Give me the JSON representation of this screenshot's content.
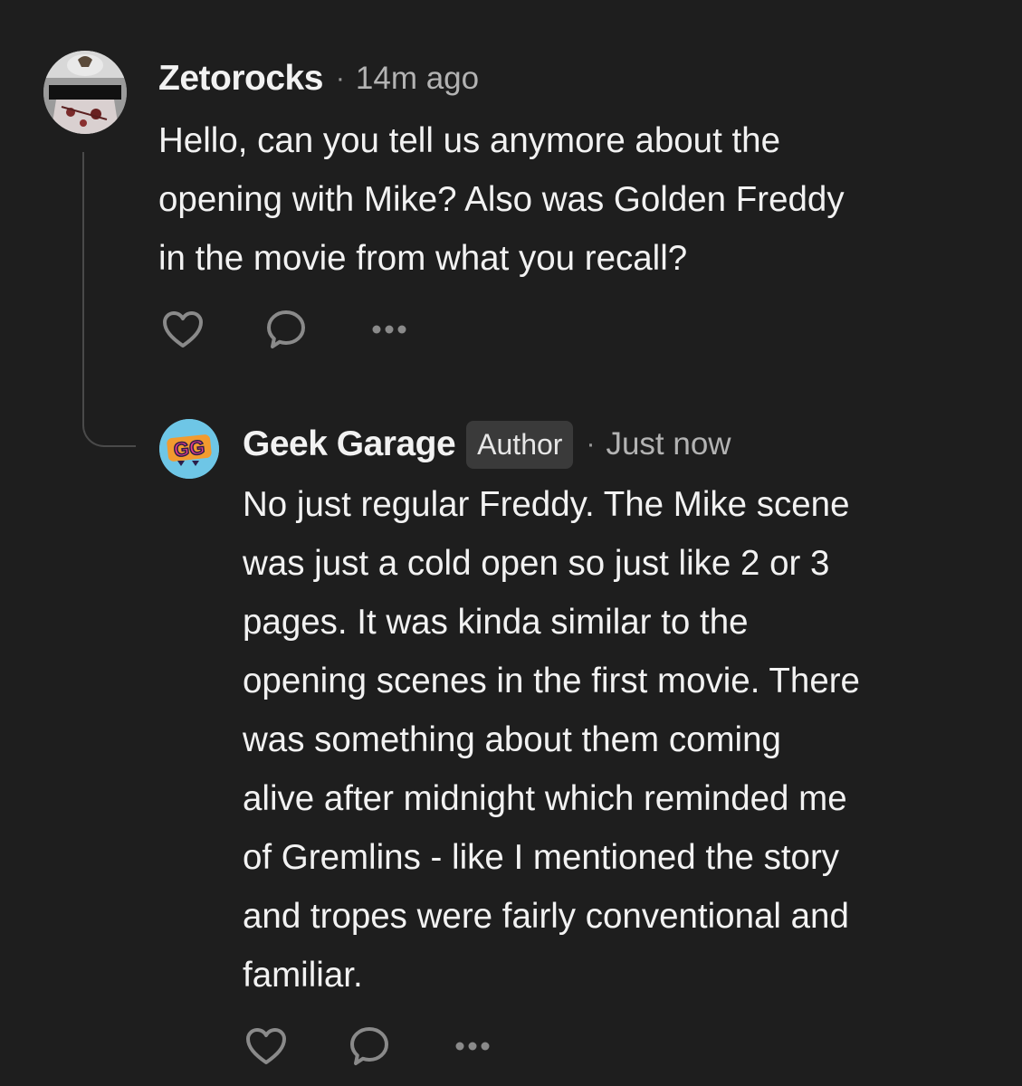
{
  "comments": [
    {
      "username": "Zetorocks",
      "separator": "·",
      "time": "14m ago",
      "avatar_icon": "user-avatar-icon",
      "lines": [
        "Hello, can you tell us anymore about the",
        "opening with Mike? Also was Golden Freddy",
        "in the movie from what you recall?"
      ],
      "actions": [
        "heart-icon",
        "comment-bubble-icon",
        "more-options-icon"
      ]
    },
    {
      "username": "Geek Garage",
      "badge": "Author",
      "separator": "·",
      "time": "Just now",
      "avatar_text": "GG",
      "lines": [
        "No just regular Freddy. The Mike scene",
        "was just a cold open so just like 2 or 3",
        "pages. It was kinda similar to the",
        "opening scenes in the first movie. There",
        "was something about them coming",
        "alive after midnight which reminded me",
        "of Gremlins - like I mentioned the story",
        "and tropes were fairly conventional and",
        "familiar."
      ],
      "actions": [
        "heart-icon",
        "comment-bubble-icon",
        "more-options-icon"
      ]
    }
  ],
  "colors": {
    "background": "#1e1e1e",
    "text": "#f2f2f2",
    "muted": "#b3b3b3",
    "icon": "#8a8a8a",
    "badge_bg": "#3a3a3a",
    "thread_line": "#4a4a4a",
    "author_avatar": "#6ec6e6"
  }
}
